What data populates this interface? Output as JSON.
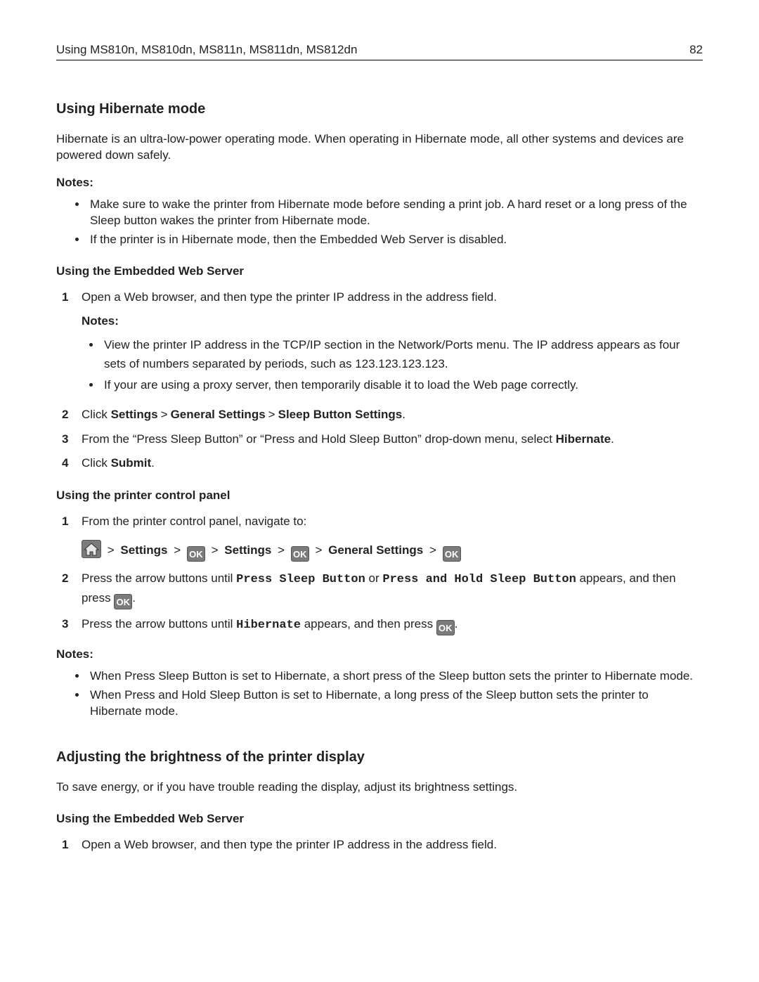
{
  "header": {
    "title": "Using MS810n, MS810dn, MS811n, MS811dn, MS812dn",
    "page": "82"
  },
  "h_hib": "Using Hibernate mode",
  "hib_intro": "Hibernate is an ultra-low-power operating mode. When operating in Hibernate mode, all other systems and devices are powered down safely.",
  "notes_label": "Notes:",
  "hib_notes": {
    "n1": "Make sure to wake the printer from Hibernate mode before sending a print job. A hard reset or a long press of the Sleep button wakes the printer from Hibernate mode.",
    "n2": "If the printer is in Hibernate mode, then the Embedded Web Server is disabled."
  },
  "h_ews": "Using the Embedded Web Server",
  "ews_steps": {
    "s1": "Open a Web browser, and then type the printer IP address in the address field.",
    "s1_notes_label": "Notes:",
    "s1_n1": "View the printer IP address in the TCP/IP section in the Network/Ports menu. The IP address appears as four sets of numbers separated by periods, such as 123.123.123.123.",
    "s1_n2": "If your are using a proxy server, then temporarily disable it to load the Web page correctly.",
    "s2_pre": "Click ",
    "s2_a": "Settings",
    "s2_b": "General Settings",
    "s2_c": "Sleep Button Settings",
    "s3_pre": "From the “Press Sleep Button” or “Press and Hold Sleep Button” drop-down menu, select ",
    "s3_val": "Hibernate",
    "s4_pre": "Click ",
    "s4_val": "Submit"
  },
  "h_cp": "Using the printer control panel",
  "cp_steps": {
    "s1": "From the printer control panel, navigate to:",
    "path_a": "Settings",
    "path_b": "Settings",
    "path_c": "General Settings",
    "s2_pre": "Press the arrow buttons until ",
    "s2_opt1": "Press Sleep Button",
    "s2_or": " or ",
    "s2_opt2": "Press and Hold Sleep Button",
    "s2_post1": " appears, and then press ",
    "s3_pre": "Press the arrow buttons until ",
    "s3_val": "Hibernate",
    "s3_post": " appears, and then press "
  },
  "ok_label": "OK",
  "gt": ">",
  "dot": ".",
  "cp_notes": {
    "n1": "When Press Sleep Button is set to Hibernate, a short press of the Sleep button sets the printer to Hibernate mode.",
    "n2": "When Press and Hold Sleep Button is set to Hibernate, a long press of the Sleep button sets the printer to Hibernate mode."
  },
  "h_bright": "Adjusting the brightness of the printer display",
  "bright_intro": "To save energy, or if you have trouble reading the display, adjust its brightness settings.",
  "bright_s1": "Open a Web browser, and then type the printer IP address in the address field."
}
